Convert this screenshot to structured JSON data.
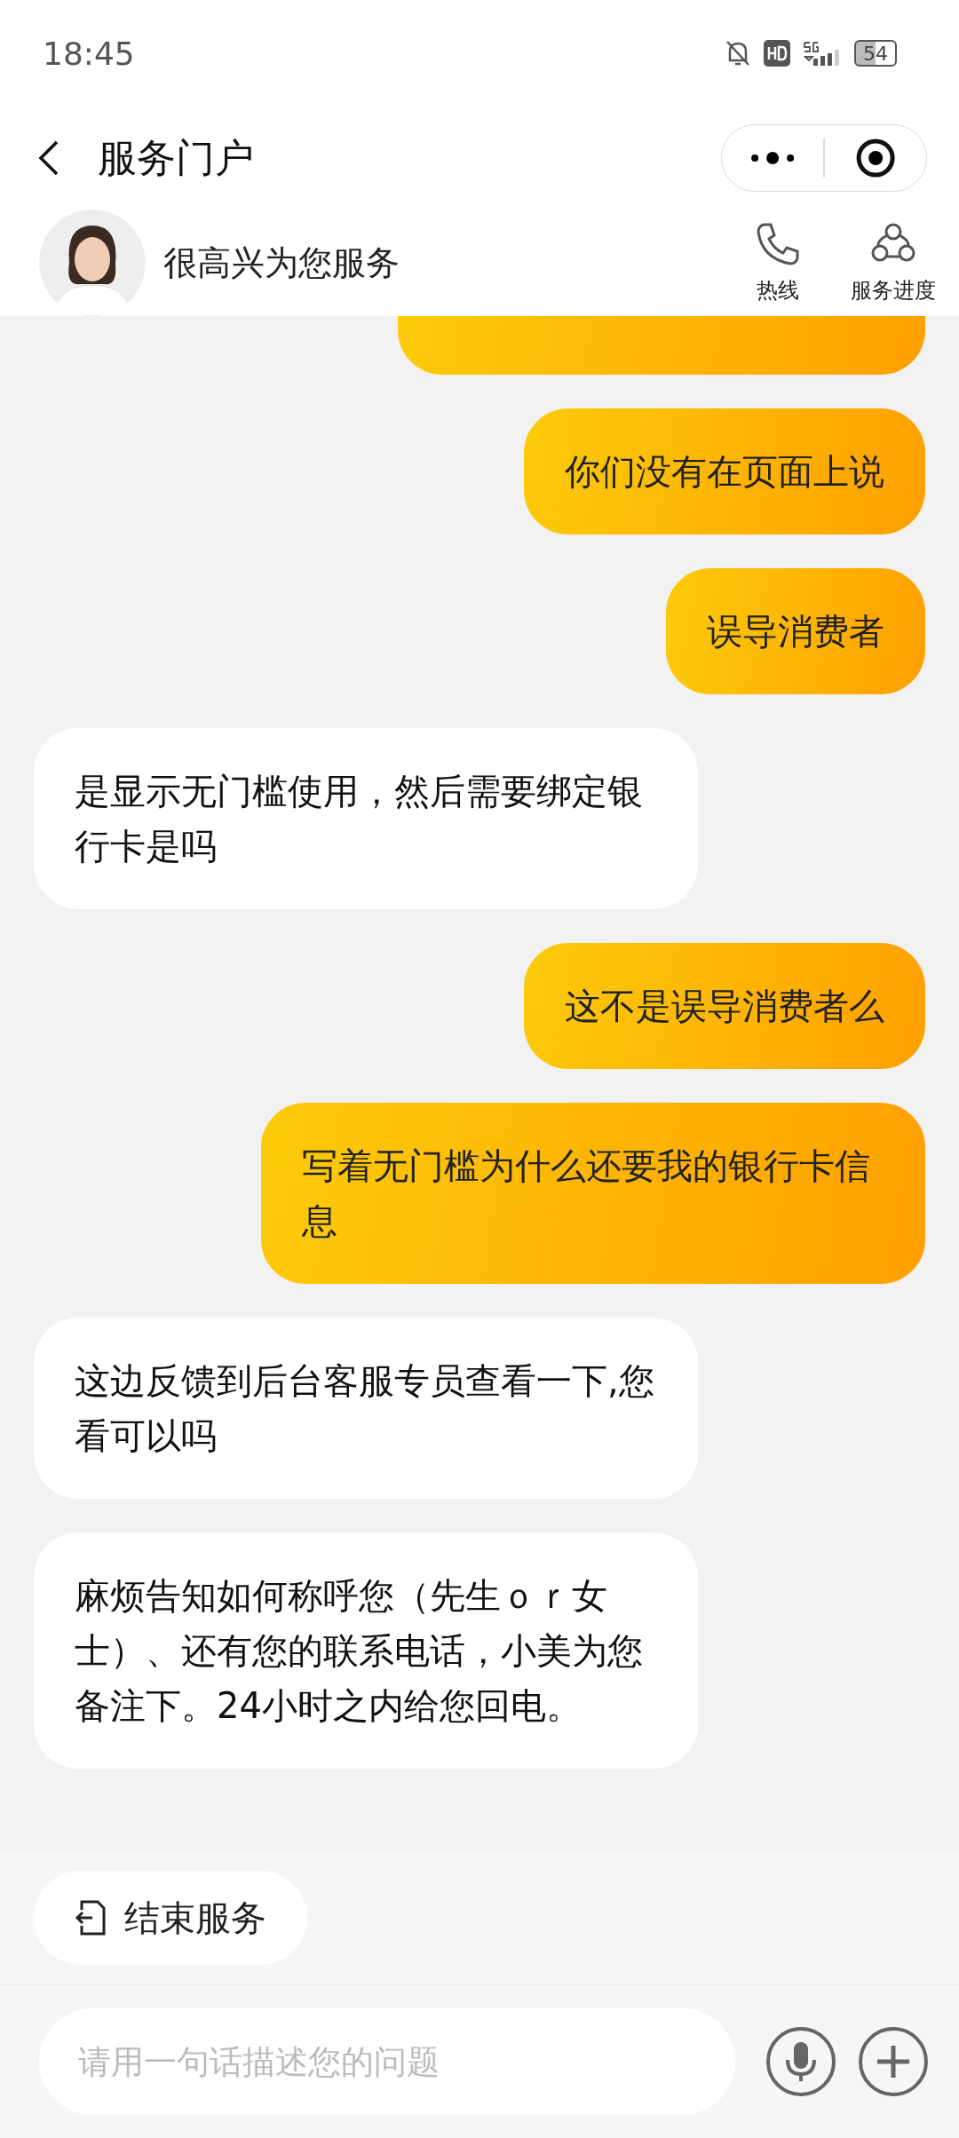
{
  "status_bar": {
    "time": "18:45",
    "battery": "54"
  },
  "nav": {
    "title": "服务门户"
  },
  "agent": {
    "greeting": "很高兴为您服务",
    "actions": [
      {
        "kind": "phone",
        "label": "热线"
      },
      {
        "kind": "progress",
        "label": "服务进度"
      }
    ]
  },
  "messages": [
    {
      "kind": "sent",
      "clipped": true
    },
    {
      "kind": "sent",
      "text": "你们没有在页面上说"
    },
    {
      "kind": "sent",
      "text": "误导消费者"
    },
    {
      "kind": "received",
      "text": "是显示无门槛使用，然后需要绑定银行卡是吗"
    },
    {
      "kind": "sent",
      "text": "这不是误导消费者么"
    },
    {
      "kind": "sent",
      "text": "写着无门槛为什么还要我的银行卡信息"
    },
    {
      "kind": "received",
      "text": "这边反馈到后台客服专员查看一下,您看可以吗"
    },
    {
      "kind": "received",
      "text": "麻烦告知如何称呼您（先生ｏｒ女士）、还有您的联系电话，小美为您备注下。24小时之内给您回电。"
    }
  ],
  "end_button": "结束服务",
  "input": {
    "placeholder": "请用一句话描述您的问题"
  }
}
